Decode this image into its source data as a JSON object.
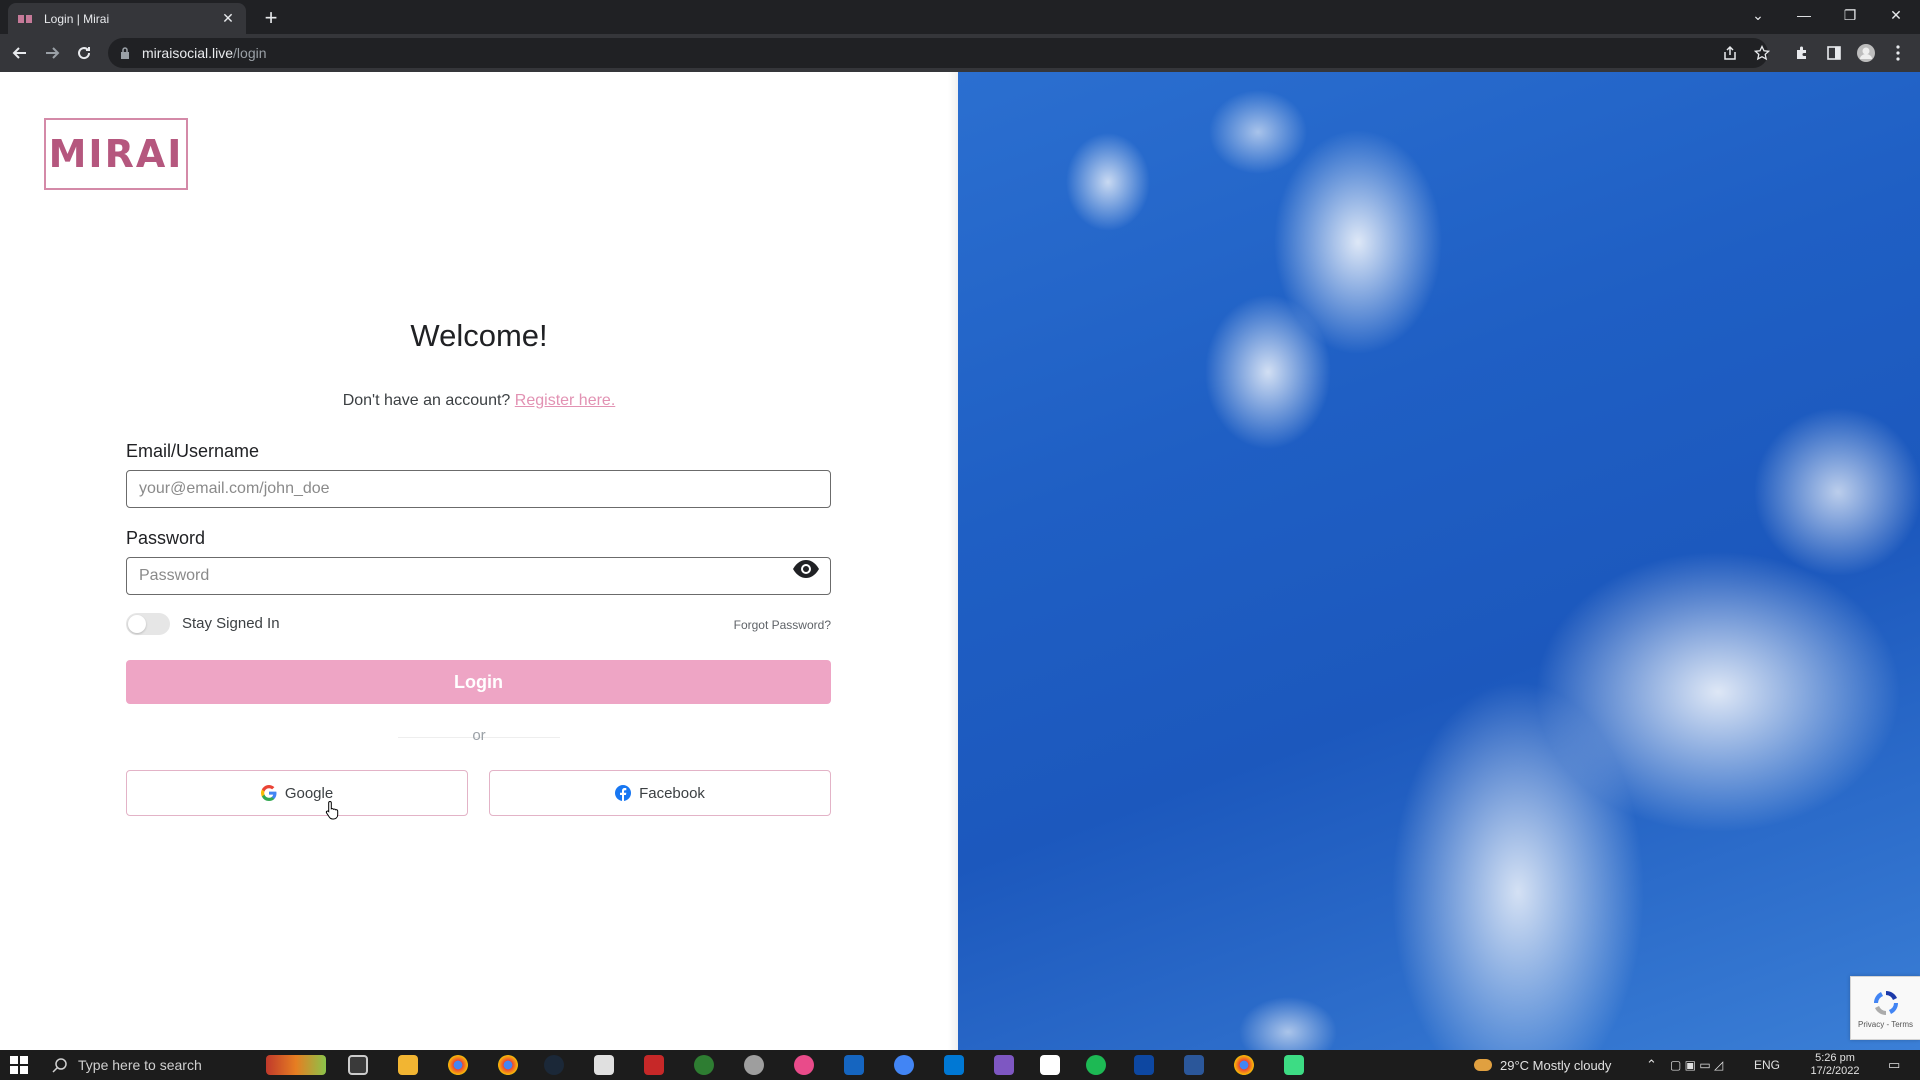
{
  "browser": {
    "tab_title": "Login | Mirai",
    "url_host": "miraisocial.live",
    "url_path": "/login"
  },
  "logo": {
    "text": "MIRAI"
  },
  "login": {
    "heading": "Welcome!",
    "register_prompt": "Don't have an account?",
    "register_link": "Register here.",
    "email_label": "Email/Username",
    "email_placeholder": "your@email.com/john_doe",
    "password_label": "Password",
    "password_placeholder": "Password",
    "stay_signed_in": "Stay Signed In",
    "forgot_password": "Forgot Password?",
    "login_button": "Login",
    "or_text": "or",
    "google_button": "Google",
    "facebook_button": "Facebook"
  },
  "recaptcha": {
    "links": "Privacy - Terms"
  },
  "taskbar": {
    "search_placeholder": "Type here to search",
    "weather": "29°C  Mostly cloudy",
    "language": "ENG",
    "time": "5:26 pm",
    "date": "17/2/2022"
  },
  "colors": {
    "brand": "#b5577e",
    "accent_pink": "#eea5c5",
    "link_pink": "#e292b3",
    "sky_blue": "#1f5fc4"
  },
  "icons": {
    "eye": "eye-icon",
    "google": "google-g-icon",
    "facebook": "facebook-icon"
  }
}
